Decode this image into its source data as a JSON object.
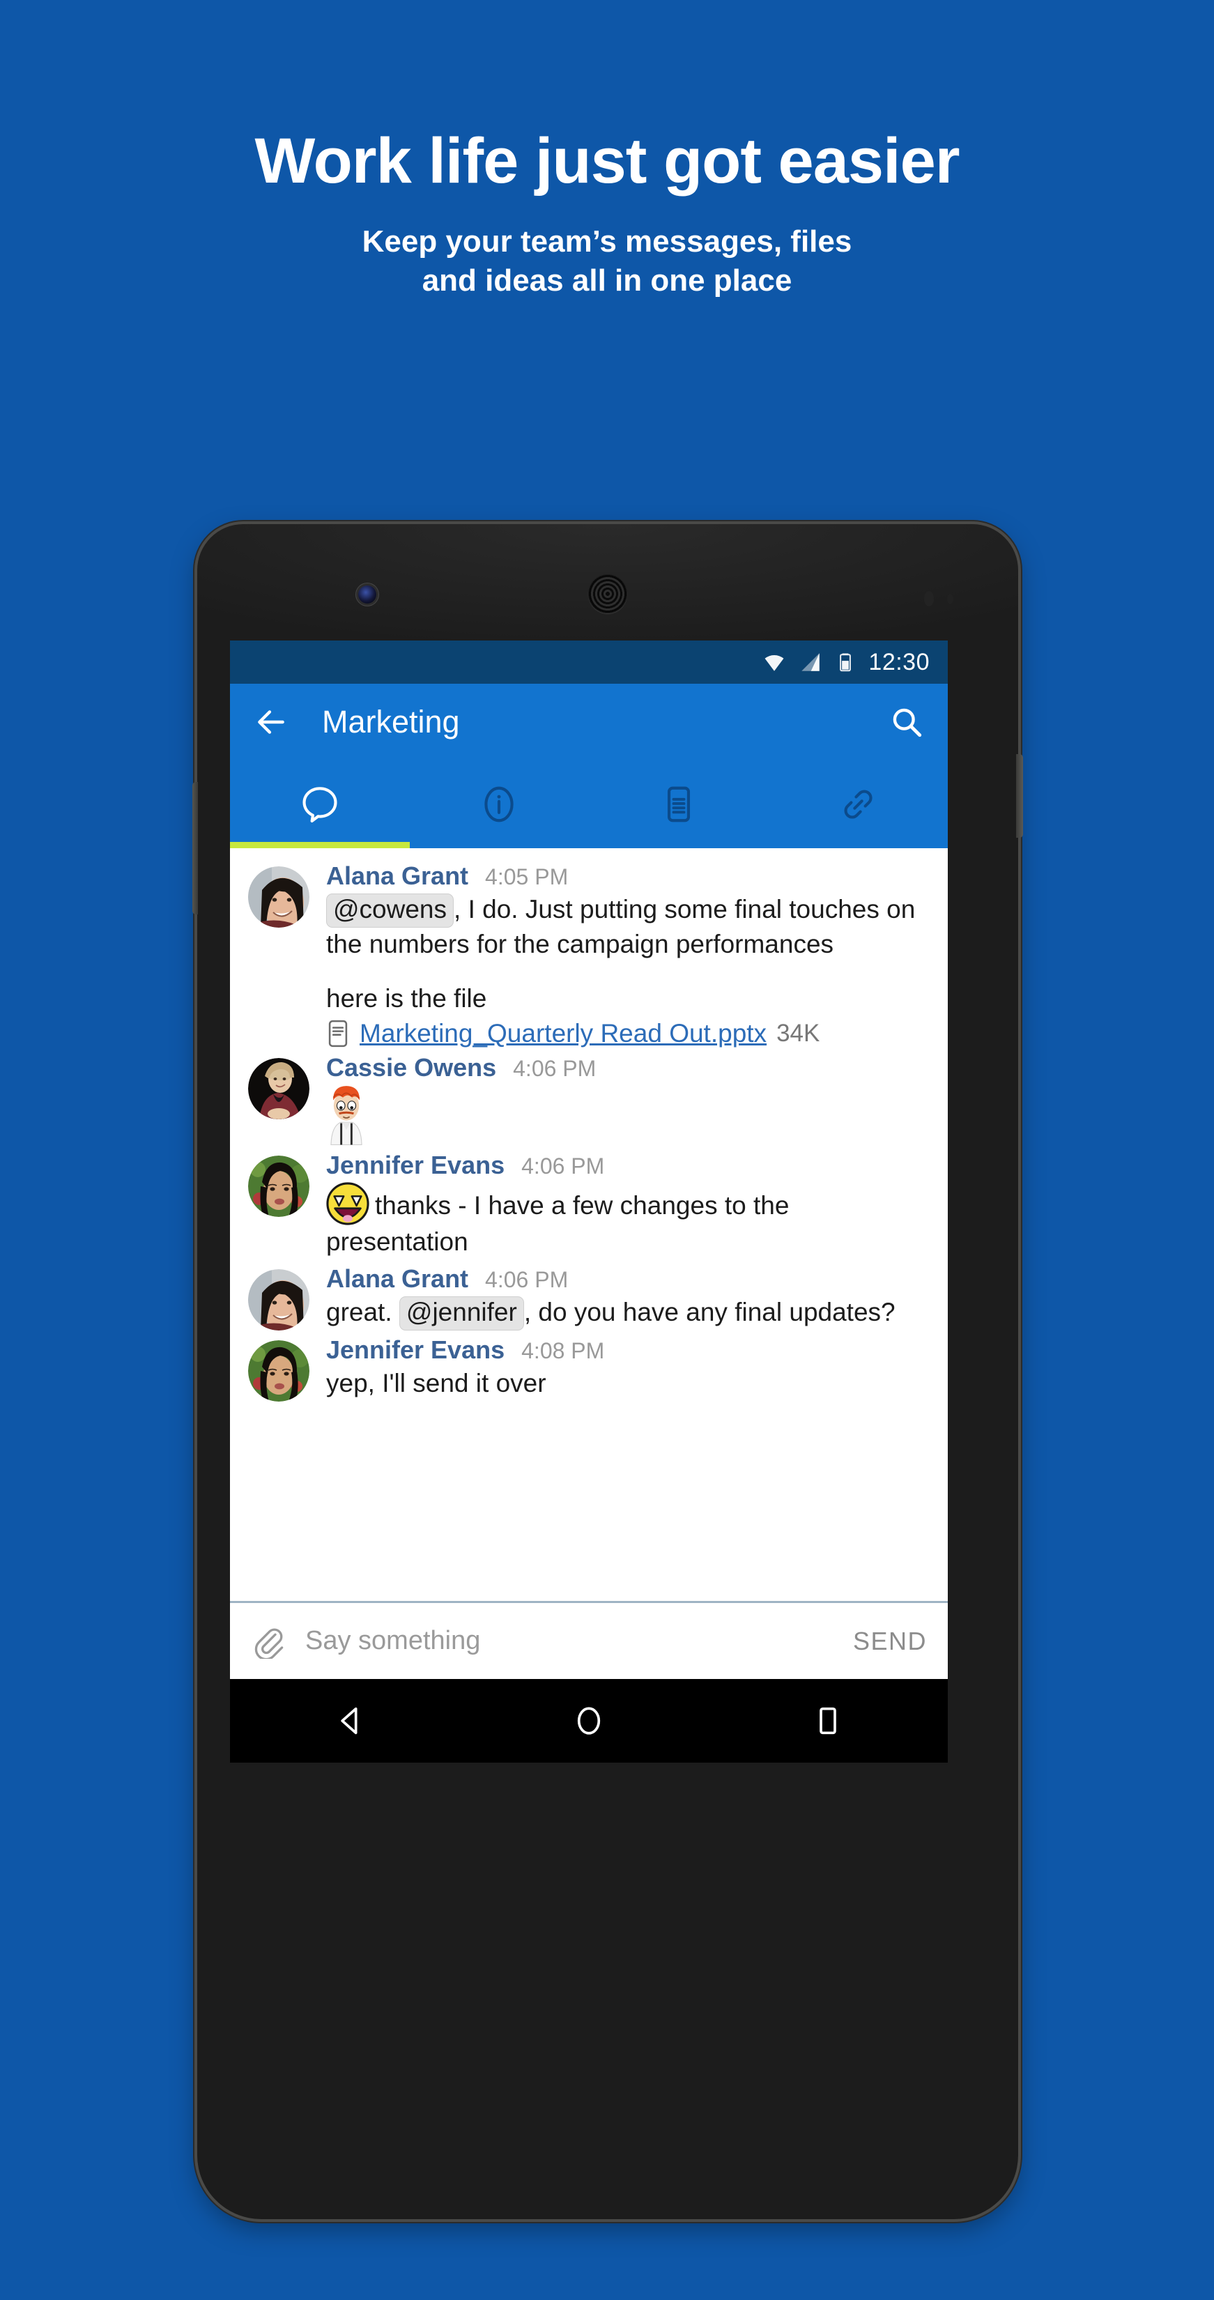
{
  "promo": {
    "title": "Work life just got easier",
    "subtitle_line1": "Keep your team’s messages, files",
    "subtitle_line2": "and ideas all in one place"
  },
  "colors": {
    "background": "#0E57A8",
    "status_bar": "#0B4371",
    "app_bar": "#1274CF",
    "tab_indicator": "#C6E83E",
    "sender_name": "#3B6194",
    "link": "#2C6CB8",
    "timestamp": "#999999"
  },
  "status_bar": {
    "time": "12:30",
    "icons": [
      "wifi-icon",
      "cell-signal-icon",
      "battery-icon"
    ]
  },
  "app_bar": {
    "back_icon": "back-arrow-icon",
    "title": "Marketing",
    "search_icon": "search-icon"
  },
  "tabs": [
    {
      "name": "chat-tab",
      "icon": "chat-bubble-icon",
      "active": true
    },
    {
      "name": "info-tab",
      "icon": "info-circle-icon",
      "active": false
    },
    {
      "name": "notes-tab",
      "icon": "document-lines-icon",
      "active": false
    },
    {
      "name": "links-tab",
      "icon": "link-chain-icon",
      "active": false
    }
  ],
  "messages": [
    {
      "sender": "Alana Grant",
      "time": "4:05 PM",
      "avatar": "alana-avatar",
      "mention": "@cowens",
      "text_after_mention": ", I do.  Just putting some final touches on the numbers for the campaign performances",
      "second_paragraph": "here is the file",
      "attachment": {
        "icon": "file-document-icon",
        "name": "Marketing_Quarterly Read Out.pptx",
        "size": "34K"
      }
    },
    {
      "sender": "Cassie Owens",
      "time": "4:06 PM",
      "avatar": "cassie-avatar",
      "sticker": "cartoon-man-sticker"
    },
    {
      "sender": "Jennifer Evans",
      "time": "4:06 PM",
      "avatar": "jennifer-avatar",
      "emoji": "awesome-face-emoji",
      "text": "thanks - I have a few changes to the presentation"
    },
    {
      "sender": "Alana Grant",
      "time": "4:06 PM",
      "avatar": "alana-avatar",
      "text_before_mention": "great. ",
      "mention": "@jennifer",
      "text_after_mention": ", do you have any final updates?"
    },
    {
      "sender": "Jennifer Evans",
      "time": "4:08 PM",
      "avatar": "jennifer-avatar",
      "text": "yep, I'll send it over"
    }
  ],
  "composer": {
    "attach_icon": "paperclip-icon",
    "placeholder": "Say something",
    "send_label": "SEND"
  },
  "nav_bar": {
    "back": "android-back-icon",
    "home": "android-home-icon",
    "recents": "android-recents-icon"
  }
}
